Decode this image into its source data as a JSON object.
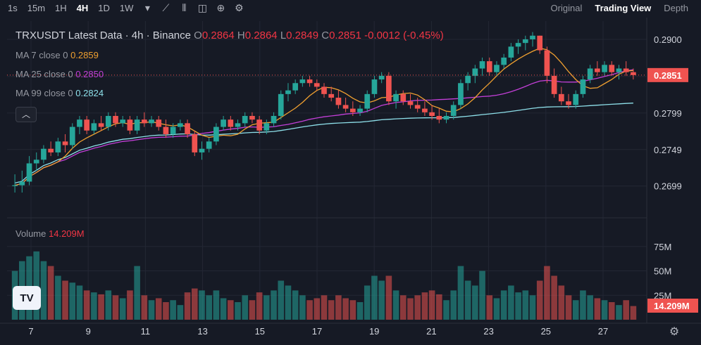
{
  "toolbar": {
    "timeframes": [
      "1s",
      "15m",
      "1H",
      "4H",
      "1D",
      "1W"
    ],
    "active_timeframe": "4H",
    "dropdown_icon": "chevron-down-icon",
    "tools": [
      "chart-style-icon",
      "candles-icon",
      "camera-icon",
      "plus-icon",
      "settings-gear-icon"
    ]
  },
  "view_tabs": [
    "Original",
    "Trading View",
    "Depth"
  ],
  "active_view": "Trading View",
  "legend": {
    "symbol": "TRXUSDT Latest Data · 4h · Binance",
    "o_label": "O",
    "o": "0.2864",
    "h_label": "H",
    "h": "0.2864",
    "l_label": "L",
    "l": "0.2849",
    "c_label": "C",
    "c": "0.2851",
    "change": "-0.0012 (-0.45%)",
    "ma7_label": "MA 7 close 0",
    "ma7": "0.2859",
    "ma7_color": "#f0a030",
    "ma25_label": "MA 25 close 0",
    "ma25": "0.2850",
    "ma25_color": "#c33fd8",
    "ma99_label": "MA 99 close 0",
    "ma99": "0.2824",
    "ma99_color": "#8ee0ea"
  },
  "collapse_icon": "chevron-up-icon",
  "volume_legend": {
    "label": "Volume",
    "value": "14.209M"
  },
  "colors": {
    "up": "#26a69a",
    "down": "#ef5350",
    "bg": "#161a25",
    "grid": "#232734"
  },
  "chart_data": {
    "type": "candlestick",
    "price_axis": {
      "ticks": [
        "0.2900",
        "0.2799",
        "0.2749",
        "0.2699"
      ],
      "last_price": "0.2851",
      "range": [
        0.2665,
        0.2925
      ]
    },
    "volume_axis": {
      "ticks": [
        "75M",
        "50M",
        "25M"
      ],
      "last_volume": "14.209M"
    },
    "x_ticks": [
      "7",
      "9",
      "11",
      "13",
      "15",
      "17",
      "19",
      "21",
      "23",
      "25",
      "27"
    ],
    "candles": [
      [
        0.27,
        0.2715,
        0.269,
        0.27,
        50
      ],
      [
        0.27,
        0.272,
        0.269,
        0.2705,
        60
      ],
      [
        0.2705,
        0.274,
        0.27,
        0.273,
        65
      ],
      [
        0.273,
        0.2745,
        0.272,
        0.2735,
        70
      ],
      [
        0.2735,
        0.2755,
        0.273,
        0.275,
        60
      ],
      [
        0.275,
        0.276,
        0.274,
        0.2745,
        55
      ],
      [
        0.2745,
        0.2765,
        0.274,
        0.276,
        45
      ],
      [
        0.276,
        0.277,
        0.2745,
        0.2755,
        40
      ],
      [
        0.2755,
        0.2785,
        0.275,
        0.278,
        38
      ],
      [
        0.278,
        0.2795,
        0.277,
        0.279,
        35
      ],
      [
        0.279,
        0.2795,
        0.277,
        0.2775,
        30
      ],
      [
        0.2775,
        0.279,
        0.277,
        0.2785,
        28
      ],
      [
        0.2785,
        0.2795,
        0.2775,
        0.278,
        26
      ],
      [
        0.278,
        0.28,
        0.2775,
        0.2795,
        30
      ],
      [
        0.2795,
        0.28,
        0.278,
        0.2785,
        25
      ],
      [
        0.2785,
        0.2795,
        0.278,
        0.279,
        22
      ],
      [
        0.279,
        0.2795,
        0.277,
        0.2775,
        30
      ],
      [
        0.2775,
        0.2795,
        0.277,
        0.279,
        55
      ],
      [
        0.279,
        0.28,
        0.278,
        0.2785,
        25
      ],
      [
        0.2785,
        0.2795,
        0.278,
        0.279,
        20
      ],
      [
        0.279,
        0.2795,
        0.2775,
        0.278,
        22
      ],
      [
        0.278,
        0.279,
        0.2765,
        0.277,
        18
      ],
      [
        0.277,
        0.2785,
        0.2765,
        0.278,
        20
      ],
      [
        0.278,
        0.279,
        0.2775,
        0.2785,
        15
      ],
      [
        0.2785,
        0.279,
        0.2765,
        0.277,
        28
      ],
      [
        0.277,
        0.2775,
        0.274,
        0.2745,
        32
      ],
      [
        0.2745,
        0.276,
        0.2735,
        0.275,
        30
      ],
      [
        0.275,
        0.2765,
        0.2745,
        0.276,
        25
      ],
      [
        0.276,
        0.2785,
        0.2755,
        0.278,
        30
      ],
      [
        0.278,
        0.2795,
        0.2775,
        0.279,
        22
      ],
      [
        0.279,
        0.2795,
        0.2775,
        0.278,
        20
      ],
      [
        0.278,
        0.279,
        0.2775,
        0.2785,
        18
      ],
      [
        0.2785,
        0.28,
        0.278,
        0.2795,
        25
      ],
      [
        0.2795,
        0.28,
        0.2785,
        0.279,
        20
      ],
      [
        0.279,
        0.2795,
        0.277,
        0.2775,
        28
      ],
      [
        0.2775,
        0.279,
        0.277,
        0.2785,
        25
      ],
      [
        0.2785,
        0.28,
        0.278,
        0.2795,
        30
      ],
      [
        0.2795,
        0.283,
        0.279,
        0.2825,
        40
      ],
      [
        0.2825,
        0.284,
        0.2815,
        0.283,
        35
      ],
      [
        0.283,
        0.2845,
        0.2825,
        0.284,
        30
      ],
      [
        0.284,
        0.285,
        0.2835,
        0.2845,
        25
      ],
      [
        0.2845,
        0.285,
        0.2835,
        0.284,
        20
      ],
      [
        0.284,
        0.2845,
        0.283,
        0.2835,
        22
      ],
      [
        0.2835,
        0.284,
        0.282,
        0.2825,
        25
      ],
      [
        0.2825,
        0.2835,
        0.2815,
        0.282,
        20
      ],
      [
        0.282,
        0.283,
        0.2805,
        0.281,
        25
      ],
      [
        0.281,
        0.282,
        0.28,
        0.2805,
        22
      ],
      [
        0.2805,
        0.2815,
        0.2795,
        0.28,
        20
      ],
      [
        0.28,
        0.281,
        0.2795,
        0.2805,
        18
      ],
      [
        0.2805,
        0.283,
        0.28,
        0.2825,
        35
      ],
      [
        0.2825,
        0.285,
        0.282,
        0.2845,
        45
      ],
      [
        0.2845,
        0.2855,
        0.284,
        0.285,
        40
      ],
      [
        0.285,
        0.2855,
        0.281,
        0.2815,
        45
      ],
      [
        0.2815,
        0.283,
        0.2805,
        0.2825,
        30
      ],
      [
        0.2825,
        0.283,
        0.281,
        0.2815,
        25
      ],
      [
        0.2815,
        0.2825,
        0.2805,
        0.281,
        22
      ],
      [
        0.281,
        0.282,
        0.28,
        0.2805,
        25
      ],
      [
        0.2805,
        0.2815,
        0.2795,
        0.28,
        28
      ],
      [
        0.28,
        0.281,
        0.279,
        0.2795,
        30
      ],
      [
        0.2795,
        0.2805,
        0.2785,
        0.279,
        26
      ],
      [
        0.279,
        0.28,
        0.2785,
        0.2795,
        20
      ],
      [
        0.2795,
        0.2815,
        0.279,
        0.281,
        30
      ],
      [
        0.281,
        0.2845,
        0.2805,
        0.284,
        55
      ],
      [
        0.284,
        0.2855,
        0.283,
        0.285,
        40
      ],
      [
        0.285,
        0.2865,
        0.284,
        0.286,
        35
      ],
      [
        0.286,
        0.2875,
        0.285,
        0.287,
        50
      ],
      [
        0.287,
        0.2875,
        0.285,
        0.2855,
        25
      ],
      [
        0.2855,
        0.287,
        0.285,
        0.2865,
        22
      ],
      [
        0.2865,
        0.288,
        0.286,
        0.2875,
        30
      ],
      [
        0.2875,
        0.2895,
        0.287,
        0.289,
        35
      ],
      [
        0.289,
        0.29,
        0.288,
        0.2895,
        28
      ],
      [
        0.2895,
        0.2905,
        0.2885,
        0.29,
        30
      ],
      [
        0.29,
        0.291,
        0.289,
        0.2905,
        25
      ],
      [
        0.2905,
        0.2905,
        0.288,
        0.2885,
        40
      ],
      [
        0.2885,
        0.289,
        0.284,
        0.285,
        55
      ],
      [
        0.285,
        0.286,
        0.282,
        0.2825,
        45
      ],
      [
        0.2825,
        0.2835,
        0.281,
        0.2815,
        35
      ],
      [
        0.2815,
        0.2825,
        0.2805,
        0.281,
        25
      ],
      [
        0.281,
        0.283,
        0.2805,
        0.2825,
        20
      ],
      [
        0.2825,
        0.285,
        0.282,
        0.2845,
        30
      ],
      [
        0.2845,
        0.2865,
        0.284,
        0.286,
        25
      ],
      [
        0.286,
        0.287,
        0.285,
        0.2855,
        22
      ],
      [
        0.2855,
        0.287,
        0.285,
        0.2865,
        20
      ],
      [
        0.2865,
        0.287,
        0.285,
        0.2855,
        18
      ],
      [
        0.2855,
        0.2865,
        0.2845,
        0.286,
        15
      ],
      [
        0.286,
        0.287,
        0.285,
        0.2855,
        20
      ],
      [
        0.2855,
        0.286,
        0.2845,
        0.2851,
        14
      ]
    ]
  }
}
